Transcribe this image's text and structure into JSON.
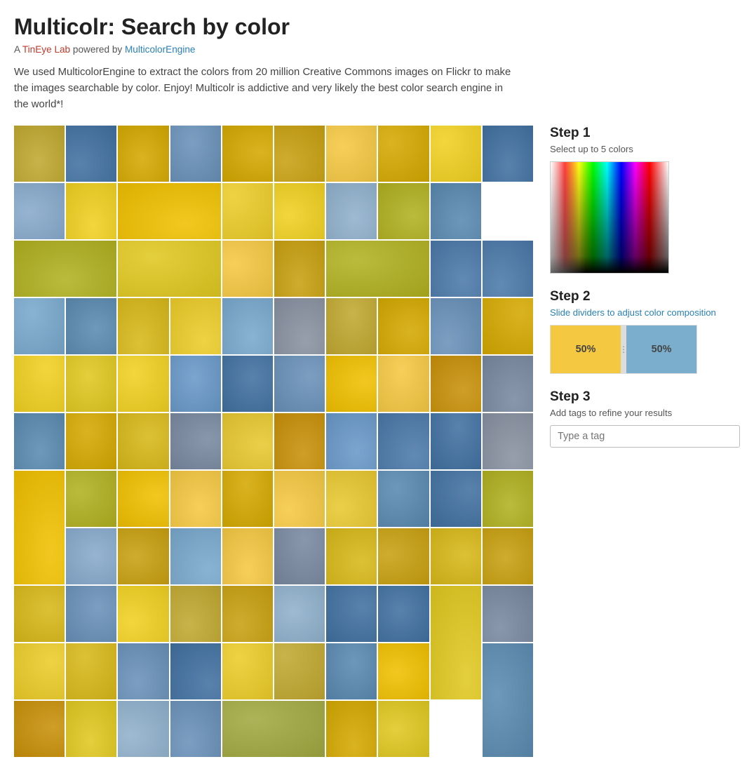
{
  "header": {
    "title": "Multicolr: Search by color",
    "subtitle_prefix": "A ",
    "subtitle_lab": "TinEye Lab",
    "subtitle_middle": " powered by ",
    "subtitle_engine": "MulticolorEngine"
  },
  "description": {
    "text": "We used MulticolorEngine to extract the colors from 20 million Creative Commons images on Flickr to make the images searchable by color. Enjoy! Multicolr is addictive and very likely the best color search engine in the world*!"
  },
  "steps": {
    "step1": {
      "title": "Step 1",
      "subtitle": "Select up to 5 colors"
    },
    "step2": {
      "title": "Step 2",
      "subtitle": "Slide dividers to adjust color composition"
    },
    "step3": {
      "title": "Step 3",
      "subtitle": "Add tags to refine your results"
    }
  },
  "color_bars": [
    {
      "label": "50%",
      "color": "#f5c842",
      "flex": 1
    },
    {
      "label": "50%",
      "color": "#7aaecc",
      "flex": 1
    }
  ],
  "tag_input": {
    "placeholder": "Type a tag"
  },
  "grid": {
    "cells": [
      {
        "bg": "#d4a800",
        "span_col": 1,
        "span_row": 1
      },
      {
        "bg": "#87aacc",
        "span_col": 1,
        "span_row": 2
      },
      {
        "bg": "#e8c830",
        "span_col": 1,
        "span_row": 1
      },
      {
        "bg": "#c8a818",
        "span_col": 1,
        "span_row": 1
      },
      {
        "bg": "#4a8ab0",
        "span_col": 1,
        "span_row": 2
      },
      {
        "bg": "#e0c020",
        "span_col": 1,
        "span_row": 1
      },
      {
        "bg": "#d4aa10",
        "span_col": 1,
        "span_row": 1
      },
      {
        "bg": "#88aacc",
        "span_col": 1,
        "span_row": 1
      },
      {
        "bg": "#e8d040",
        "span_col": 1,
        "span_row": 1
      },
      {
        "bg": "#f0a820",
        "span_col": 1,
        "span_row": 1
      }
    ]
  }
}
